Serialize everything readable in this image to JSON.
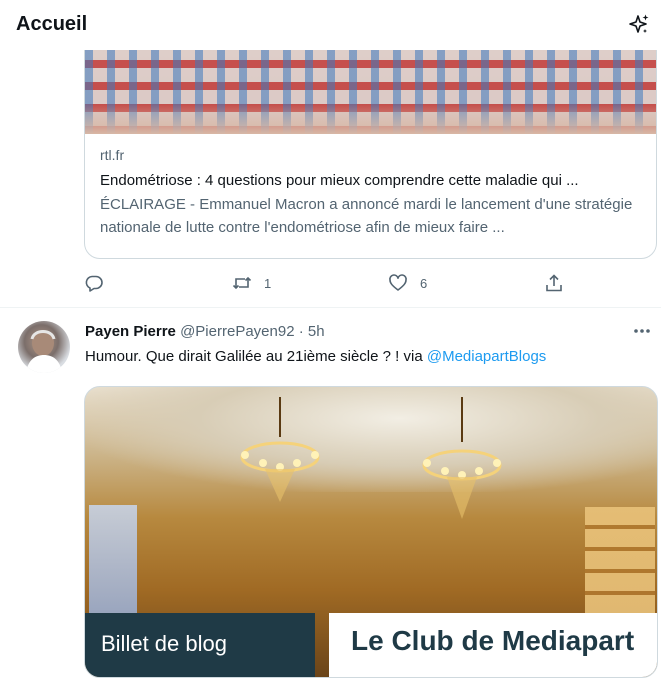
{
  "header": {
    "title": "Accueil",
    "top_tweets_icon": "sparkle-icon"
  },
  "tweet1": {
    "card": {
      "domain": "rtl.fr",
      "title": "Endométriose : 4 questions pour mieux comprendre cette maladie qui ...",
      "description": "ÉCLAIRAGE - Emmanuel Macron a annoncé mardi le lancement d'une stratégie nationale de lutte contre l'endométriose afin de mieux faire ..."
    },
    "actions": {
      "reply_icon": "reply-icon",
      "reply_count": "",
      "retweet_icon": "retweet-icon",
      "retweet_count": "1",
      "like_icon": "heart-icon",
      "like_count": "6",
      "share_icon": "share-icon"
    }
  },
  "tweet2": {
    "author_name": "Payen Pierre",
    "handle": "@PierrePayen92",
    "separator": "·",
    "time": "5h",
    "text": "Humour. Que dirait Galilée au 21ième siècle ? ! via ",
    "mention": "@MediapartBlogs",
    "card": {
      "left_label": "Billet de blog",
      "right_label": "Le Club de Mediapart"
    },
    "more_icon": "more-horizontal-icon"
  },
  "colors": {
    "accent": "#1d9bf0",
    "text_primary": "#0f1419",
    "text_secondary": "#536471",
    "border": "#cfd9de",
    "mediapart_dark": "#1f3a46"
  }
}
